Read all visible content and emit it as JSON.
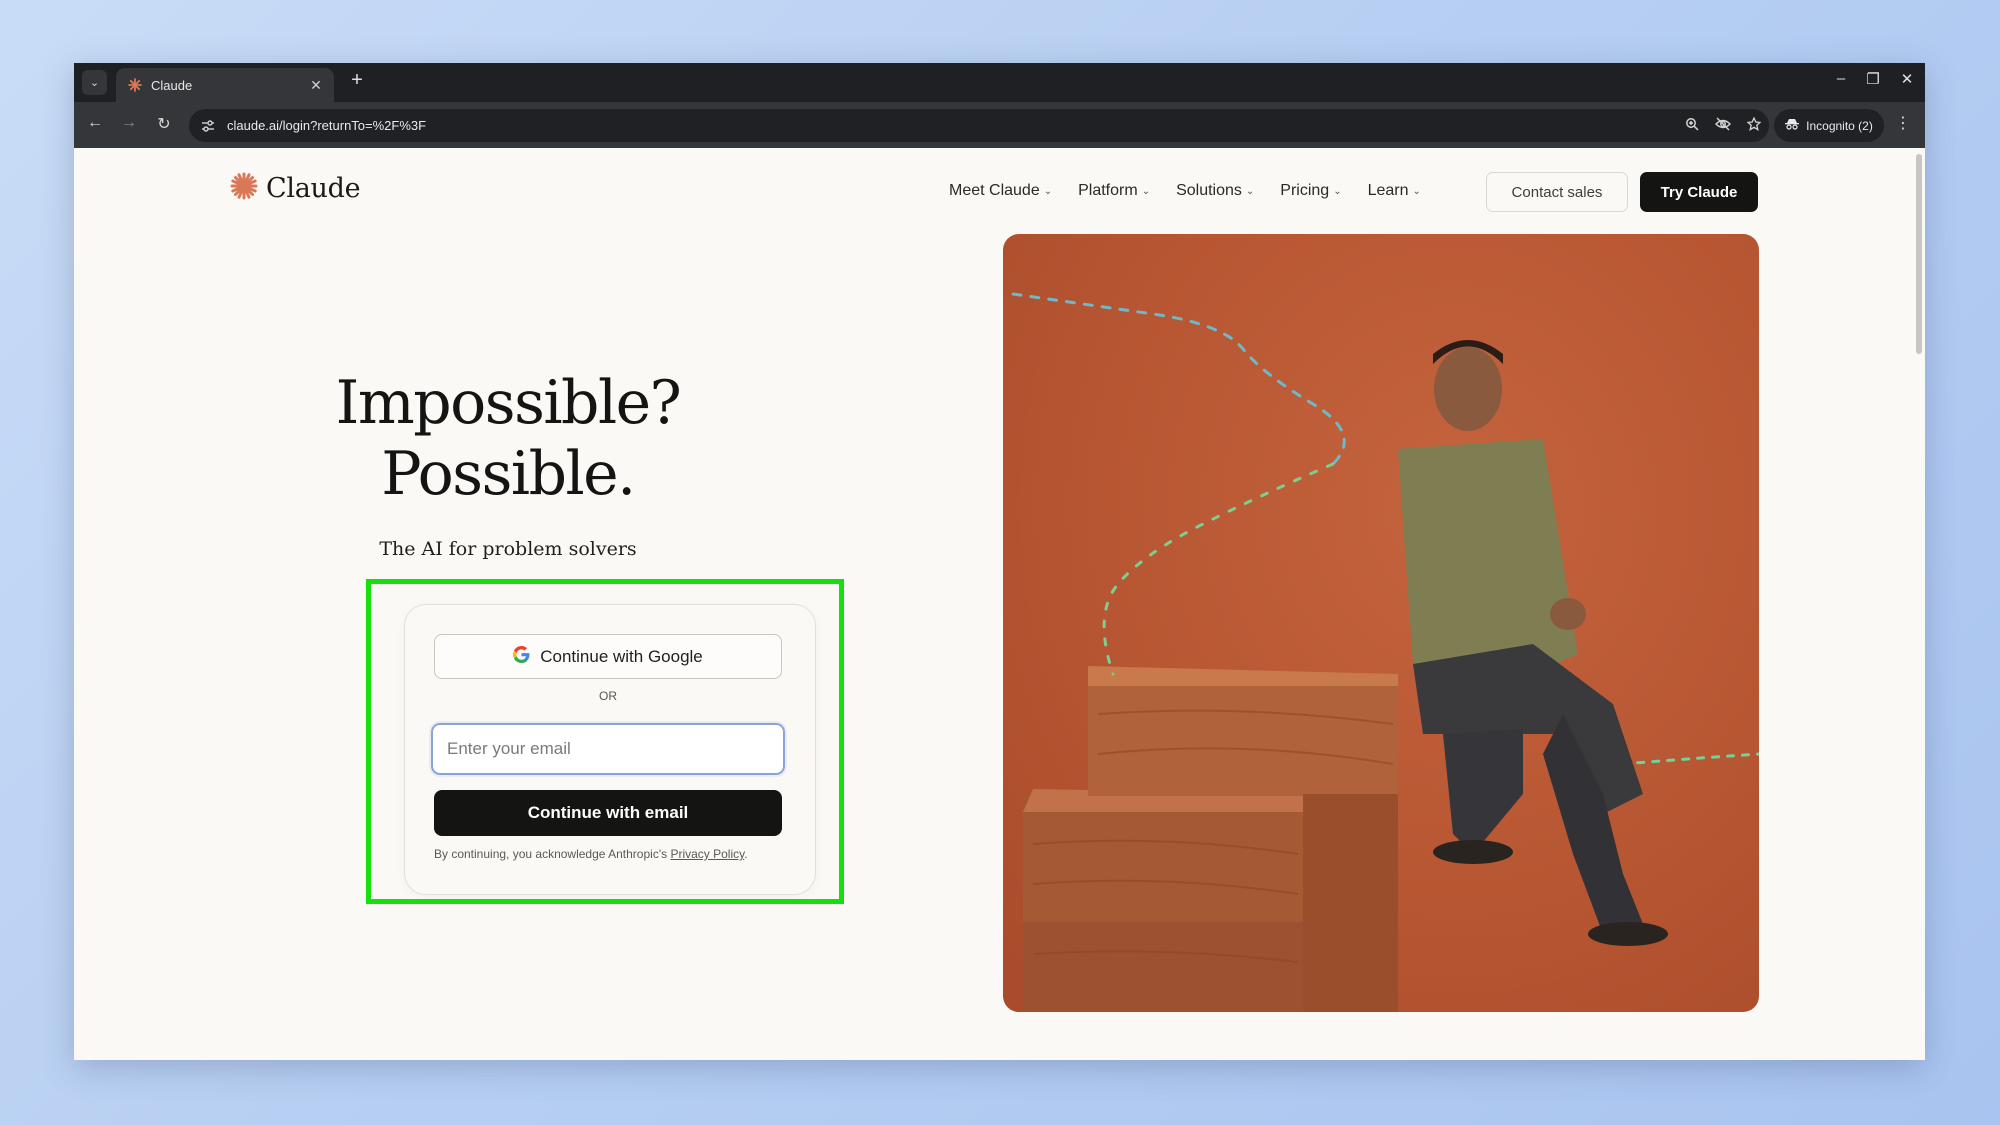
{
  "browser": {
    "tab_title": "Claude",
    "url": "claude.ai/login?returnTo=%2F%3F",
    "incognito_label": "Incognito (2)",
    "new_tab_glyph": "+",
    "tab_close_glyph": "✕",
    "back_glyph": "←",
    "forward_glyph": "→",
    "reload_glyph": "↻",
    "minimize_glyph": "–",
    "restore_glyph": "❐",
    "close_glyph": "✕",
    "menu_glyph": "⋮",
    "tab_search_glyph": "⌄"
  },
  "header": {
    "logo_text": "Claude",
    "logo_color": "#d97757",
    "nav": [
      {
        "label": "Meet Claude"
      },
      {
        "label": "Platform"
      },
      {
        "label": "Solutions"
      },
      {
        "label": "Pricing"
      },
      {
        "label": "Learn"
      }
    ],
    "chevron_glyph": "⌄",
    "contact_label": "Contact sales",
    "try_label": "Try Claude"
  },
  "hero": {
    "title_line1": "Impossible?",
    "title_line2": "Possible.",
    "subtitle": "The AI for problem solvers"
  },
  "login": {
    "google_label": "Continue with Google",
    "or_label": "OR",
    "email_placeholder": "Enter your email",
    "email_button_label": "Continue with email",
    "legal_prefix": "By continuing, you acknowledge Anthropic's",
    "privacy_link": "Privacy Policy",
    "legal_suffix": "."
  },
  "colors": {
    "highlight": "#16e00c",
    "hero_bg": "#b75632",
    "primary_button": "#141413"
  }
}
